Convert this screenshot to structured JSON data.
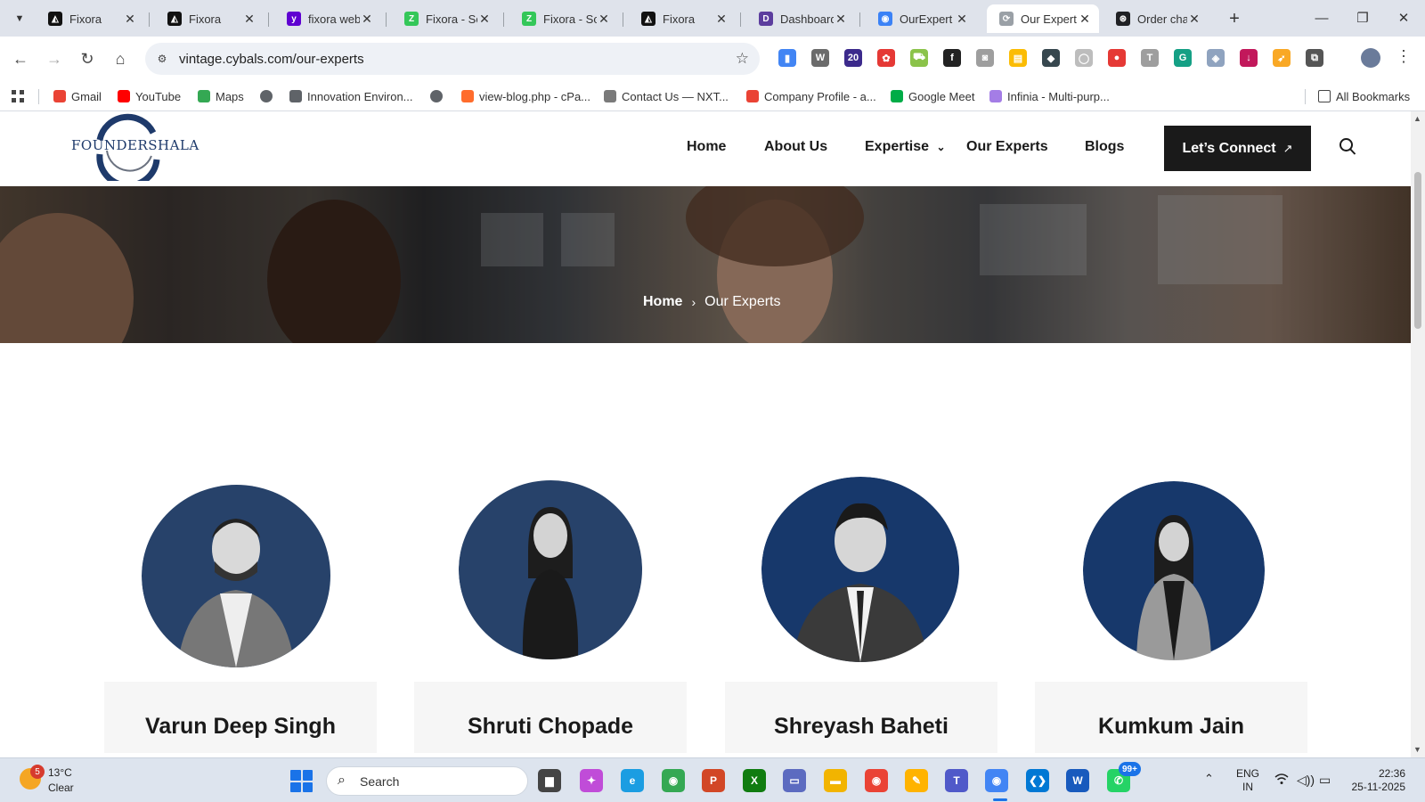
{
  "browser": {
    "tabs": [
      {
        "title": "Fixora",
        "favicon_color": "#111111",
        "favicon_glyph": "◭",
        "active": false
      },
      {
        "title": "Fixora",
        "favicon_color": "#111111",
        "favicon_glyph": "◭",
        "active": false
      },
      {
        "title": "fixora web",
        "favicon_color": "#5f01d1",
        "favicon_glyph": "y",
        "active": false
      },
      {
        "title": "Fixora - So",
        "favicon_color": "#34c759",
        "favicon_glyph": "Z",
        "active": false
      },
      {
        "title": "Fixora - So",
        "favicon_color": "#34c759",
        "favicon_glyph": "Z",
        "active": false
      },
      {
        "title": "Fixora",
        "favicon_color": "#111111",
        "favicon_glyph": "◭",
        "active": false
      },
      {
        "title": "Dashboard",
        "favicon_color": "#5c3d9e",
        "favicon_glyph": "D",
        "active": false
      },
      {
        "title": "OurExpert",
        "favicon_color": "#3b82f6",
        "favicon_glyph": "◉",
        "active": false
      },
      {
        "title": "Our Expert",
        "favicon_color": "#9aa0a6",
        "favicon_glyph": "⟳",
        "active": true
      },
      {
        "title": "Order cha",
        "favicon_color": "#202124",
        "favicon_glyph": "⊛",
        "active": false
      }
    ],
    "url": "vintage.cybals.com/our-experts",
    "extensions": [
      {
        "name": "docs-extension-icon",
        "color": "#4285f4",
        "glyph": "▮"
      },
      {
        "name": "wordpress-icon",
        "color": "#6b6b6b",
        "glyph": "W"
      },
      {
        "name": "cap-extension-icon",
        "color": "#3c2a8c",
        "glyph": "20"
      },
      {
        "name": "color-wheel-icon",
        "color": "#e53935",
        "glyph": "✿"
      },
      {
        "name": "cart-icon",
        "color": "#8bc34a",
        "glyph": "⛟"
      },
      {
        "name": "font-icon",
        "color": "#222222",
        "glyph": "f"
      },
      {
        "name": "camera-icon",
        "color": "#9e9e9e",
        "glyph": "◙"
      },
      {
        "name": "note-icon",
        "color": "#fbbc04",
        "glyph": "▤"
      },
      {
        "name": "shield-dark-icon",
        "color": "#37474f",
        "glyph": "◆"
      },
      {
        "name": "mouse-icon",
        "color": "#bdbdbd",
        "glyph": "◯"
      },
      {
        "name": "pokeball-icon",
        "color": "#e53935",
        "glyph": "●"
      },
      {
        "name": "text-icon",
        "color": "#9e9e9e",
        "glyph": "T"
      },
      {
        "name": "grammarly-icon",
        "color": "#15a085",
        "glyph": "G"
      },
      {
        "name": "shield-icon",
        "color": "#8fa3bf",
        "glyph": "◈"
      },
      {
        "name": "download-icon",
        "color": "#c2185b",
        "glyph": "↓"
      },
      {
        "name": "rocket-icon",
        "color": "#f9a825",
        "glyph": "➶"
      },
      {
        "name": "puzzle-icon",
        "color": "#555555",
        "glyph": "⧉"
      }
    ]
  },
  "bookmarks": {
    "items": [
      {
        "label": "Gmail",
        "icon_color": "#ea4335"
      },
      {
        "label": "YouTube",
        "icon_color": "#ff0000"
      },
      {
        "label": "Maps",
        "icon_color": "#34a853"
      },
      {
        "label": "",
        "icon_color": "#5f6368"
      },
      {
        "label": "Innovation Environ...",
        "icon_color": "#5f6368"
      },
      {
        "label": "",
        "icon_color": "#5f6368"
      },
      {
        "label": "view-blog.php - cPa...",
        "icon_color": "#ff6c2c"
      },
      {
        "label": "Contact Us — NXT...",
        "icon_color": "#7a7a7a"
      },
      {
        "label": "Company Profile - a...",
        "icon_color": "#ea4335"
      },
      {
        "label": "Google Meet",
        "icon_color": "#00ac47"
      },
      {
        "label": "Infinia - Multi-purp...",
        "icon_color": "#a47de6"
      }
    ],
    "all_bookmarks": "All Bookmarks"
  },
  "site": {
    "logo_text": "FOUNDERSHALA",
    "nav": [
      "Home",
      "About Us",
      "Expertise",
      "Our Experts",
      "Blogs"
    ],
    "cta_label": "Let’s Connect",
    "breadcrumb": {
      "home": "Home",
      "current": "Our Experts"
    },
    "experts": [
      {
        "name": "Varun Deep Singh",
        "photo_bg": "#27426a"
      },
      {
        "name": "Shruti Chopade",
        "photo_bg": "#27426a"
      },
      {
        "name": "Shreyash Baheti",
        "photo_bg": "#17386b"
      },
      {
        "name": "Kumkum Jain",
        "photo_bg": "#17386b"
      }
    ]
  },
  "taskbar": {
    "weather": {
      "badge": "5",
      "temp": "13°C",
      "condition": "Clear"
    },
    "search_label": "Search",
    "whatsapp_badge": "99+",
    "lang": [
      "ENG",
      "IN"
    ],
    "time": "22:36",
    "date": "25-11-2025",
    "apps": [
      {
        "name": "file-explorer-dark-icon",
        "color": "#444444",
        "glyph": "▆"
      },
      {
        "name": "copilot-icon",
        "color": "#c04cd8",
        "glyph": "✦"
      },
      {
        "name": "edge-icon",
        "color": "#1b9de2",
        "glyph": "e"
      },
      {
        "name": "chrome-icon",
        "color": "#34a853",
        "glyph": "◉"
      },
      {
        "name": "powerpoint-icon",
        "color": "#d24726",
        "glyph": "P"
      },
      {
        "name": "xbox-icon",
        "color": "#107c10",
        "glyph": "X"
      },
      {
        "name": "terminal-icon",
        "color": "#5c6bc0",
        "glyph": "▭"
      },
      {
        "name": "folder-icon",
        "color": "#f2b400",
        "glyph": "▬"
      },
      {
        "name": "chrome-secondary-icon",
        "color": "#ea4335",
        "glyph": "◉"
      },
      {
        "name": "paint-icon",
        "color": "#ffb300",
        "glyph": "✎"
      },
      {
        "name": "teams-icon",
        "color": "#5059c9",
        "glyph": "T"
      },
      {
        "name": "chrome-active-icon",
        "color": "#4285f4",
        "glyph": "◉"
      },
      {
        "name": "vscode-icon",
        "color": "#0078d4",
        "glyph": "❮❯"
      },
      {
        "name": "word-icon",
        "color": "#185abd",
        "glyph": "W"
      },
      {
        "name": "whatsapp-icon",
        "color": "#25d366",
        "glyph": "✆"
      }
    ]
  }
}
